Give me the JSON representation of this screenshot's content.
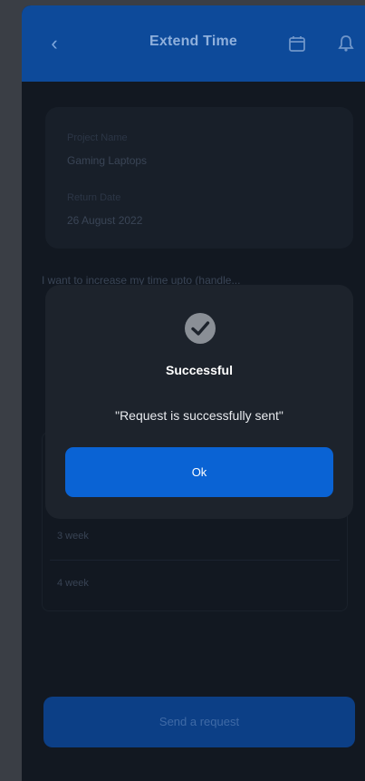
{
  "header": {
    "title": "Extend Time",
    "back_icon": "chevron-left-icon",
    "calendar_icon": "calendar-icon",
    "notification_icon": "bell-icon"
  },
  "project_card": {
    "project_label": "Project Name",
    "project_value": "Gaming Laptops",
    "return_label": "Return Date",
    "return_value": "26 August 2022"
  },
  "intro_text": "I want to increase my time upto (handle...",
  "options": [
    "3 week",
    "4 week"
  ],
  "send_button": {
    "label": "Send a request"
  },
  "modal": {
    "icon": "check-circle-icon",
    "title": "Successful",
    "message": "\"Request is successfully sent\"",
    "ok_label": "Ok"
  },
  "colors": {
    "accent": "#0a63d4",
    "header": "#0d4a9a",
    "background": "#121821",
    "modal": "#1d232c"
  }
}
